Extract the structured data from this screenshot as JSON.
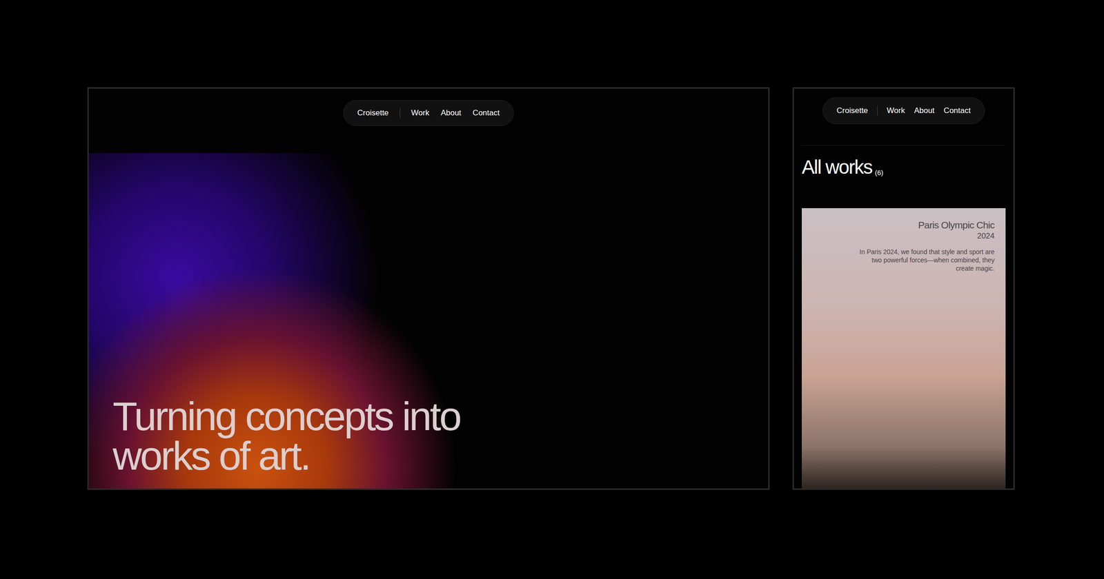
{
  "screens": [
    {
      "nav": {
        "brand": "Croisette",
        "links": [
          "Work",
          "About",
          "Contact"
        ]
      },
      "hero": {
        "lines": [
          "Turning concepts into",
          "works of art."
        ]
      }
    },
    {
      "nav": {
        "brand": "Croisette",
        "links": [
          "Work",
          "About",
          "Contact"
        ]
      },
      "heading": "All works",
      "count": "(6)",
      "works": [
        {
          "title": "Paris Olympic Chic",
          "year": "2024",
          "description": "In Paris 2024, we found that style and sport are two powerful forces—when combined, they create magic."
        }
      ]
    }
  ]
}
